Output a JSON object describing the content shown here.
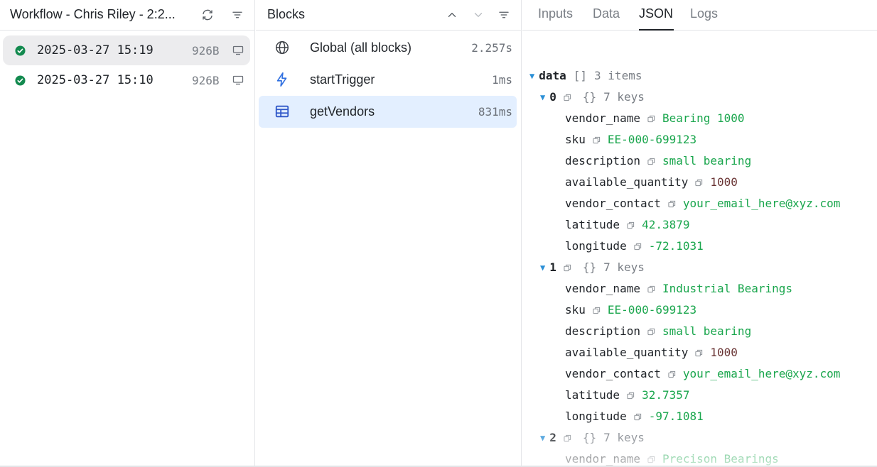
{
  "runs": {
    "title": "Workflow - Chris Riley - 2:2...",
    "icons": {
      "refresh": "refresh-icon",
      "filter": "filter-icon"
    },
    "items": [
      {
        "timestamp": "2025-03-27 15:19",
        "size": "926B",
        "status": "success",
        "selected": true
      },
      {
        "timestamp": "2025-03-27 15:10",
        "size": "926B",
        "status": "success",
        "selected": false
      }
    ]
  },
  "blocks": {
    "title": "Blocks",
    "icons": {
      "up": "chevron-up-icon",
      "down": "chevron-down-icon",
      "filter": "filter-icon"
    },
    "items": [
      {
        "name": "Global (all blocks)",
        "time": "2.257s",
        "icon": "globe-icon",
        "selected": false
      },
      {
        "name": "startTrigger",
        "time": "1ms",
        "icon": "lightning-icon",
        "selected": false
      },
      {
        "name": "getVendors",
        "time": "831ms",
        "icon": "table-icon",
        "selected": true
      }
    ]
  },
  "detail": {
    "tabs": [
      "Inputs",
      "Data",
      "JSON",
      "Logs"
    ],
    "active_tab": "JSON",
    "json": {
      "root_key": "data",
      "root_brackets": "[]",
      "root_meta": "3 items",
      "entries": [
        {
          "index": "0",
          "brackets": "{}",
          "meta": "7 keys",
          "fields": [
            {
              "key": "vendor_name",
              "value": "Bearing 1000",
              "type": "string"
            },
            {
              "key": "sku",
              "value": "EE-000-699123",
              "type": "string"
            },
            {
              "key": "description",
              "value": "small bearing",
              "type": "string"
            },
            {
              "key": "available_quantity",
              "value": "1000",
              "type": "number"
            },
            {
              "key": "vendor_contact",
              "value": "your_email_here@xyz.com",
              "type": "string"
            },
            {
              "key": "latitude",
              "value": "42.3879",
              "type": "string"
            },
            {
              "key": "longitude",
              "value": "-72.1031",
              "type": "string"
            }
          ]
        },
        {
          "index": "1",
          "brackets": "{}",
          "meta": "7 keys",
          "fields": [
            {
              "key": "vendor_name",
              "value": "Industrial Bearings",
              "type": "string"
            },
            {
              "key": "sku",
              "value": "EE-000-699123",
              "type": "string"
            },
            {
              "key": "description",
              "value": "small bearing",
              "type": "string"
            },
            {
              "key": "available_quantity",
              "value": "1000",
              "type": "number"
            },
            {
              "key": "vendor_contact",
              "value": "your_email_here@xyz.com",
              "type": "string"
            },
            {
              "key": "latitude",
              "value": "32.7357",
              "type": "string"
            },
            {
              "key": "longitude",
              "value": "-97.1081",
              "type": "string"
            }
          ]
        },
        {
          "index": "2",
          "brackets": "{}",
          "meta": "7 keys",
          "fields": [
            {
              "key": "vendor_name",
              "value": "Precison Bearings",
              "type": "string"
            }
          ]
        }
      ]
    }
  },
  "colors": {
    "accent_blue": "#2b8fd6",
    "success_green": "#138a4f",
    "string_green": "#1aa64d",
    "number_color": "#6a3535",
    "selected_block_bg": "#e3efff",
    "selected_run_bg": "#ececee"
  }
}
